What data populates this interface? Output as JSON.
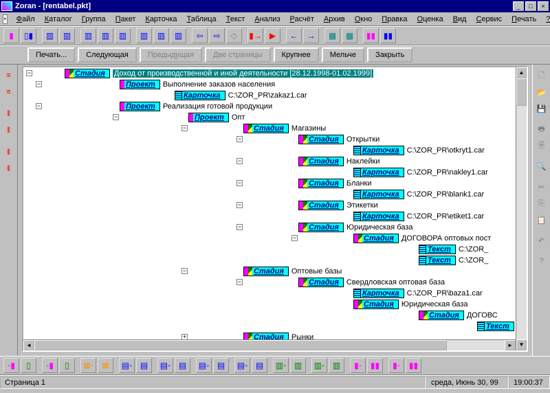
{
  "title": "Zoran - [rentabel.pkt]",
  "menu": [
    "Файл",
    "Каталог",
    "Группа",
    "Пакет",
    "Карточка",
    "Таблица",
    "Текст",
    "Анализ",
    "Расчёт",
    "Архив",
    "Окно",
    "Правка",
    "Оценка",
    "Вид",
    "Сервис",
    "Печать",
    "?"
  ],
  "menu_underline_idx": [
    0,
    0,
    0,
    0,
    0,
    0,
    0,
    0,
    0,
    0,
    0,
    0,
    0,
    0,
    0,
    0,
    0
  ],
  "print_buttons": {
    "print": "Печать...",
    "next": "Следующая",
    "prev": "Предыдущая",
    "two": "Две страницы",
    "zoomin": "Крупнее",
    "zoomout": "Мельче",
    "close": "Закрыть"
  },
  "tags": {
    "stadia": "Стадия",
    "proekt": "Проект",
    "kartochka": "Карточка",
    "tekst": "Текст"
  },
  "tree": {
    "root_label": "Доход от производственной и иной деятельности [28.12.1998-01.02.1999]",
    "n1": "Выполнение заказов населения",
    "n1k": "C:\\ZOR_PR\\zakaz1.car",
    "n2": "Реализация готовой продукции",
    "n2_1": "Опт",
    "n2_1_1": "Магазины",
    "n2_1_1_1": "Открытки",
    "n2_1_1_1k": "C:\\ZOR_PR\\otkryt1.car",
    "n2_1_1_2": "Наклейки",
    "n2_1_1_2k": "C:\\ZOR_PR\\nakley1.car",
    "n2_1_1_3": "Бланки",
    "n2_1_1_3k": "C:\\ZOR_PR\\blank1.car",
    "n2_1_1_4": "Этикетки",
    "n2_1_1_4k": "C:\\ZOR_PR\\etiket1.car",
    "n2_1_1_5": "Юридическая база",
    "n2_1_1_5d": "ДОГОВОРА оптовых пост",
    "n2_1_1_5t1": "C:\\ZOR_",
    "n2_1_1_5t2": "C:\\ZOR_",
    "n2_1_2": "Оптовые базы",
    "n2_1_2_1": "Свердловская оптовая база",
    "n2_1_2_1k": "C:\\ZOR_PR\\baza1.car",
    "n2_1_2_2": "Юридическая база",
    "n2_1_2_2d": "ДОГОВС",
    "n2_1_2_2t": "Т",
    "n2_1_3": "Рынки"
  },
  "status": {
    "page": "Страница 1",
    "date": "среда, Июнь 30, 99",
    "time": "19:00:37"
  }
}
